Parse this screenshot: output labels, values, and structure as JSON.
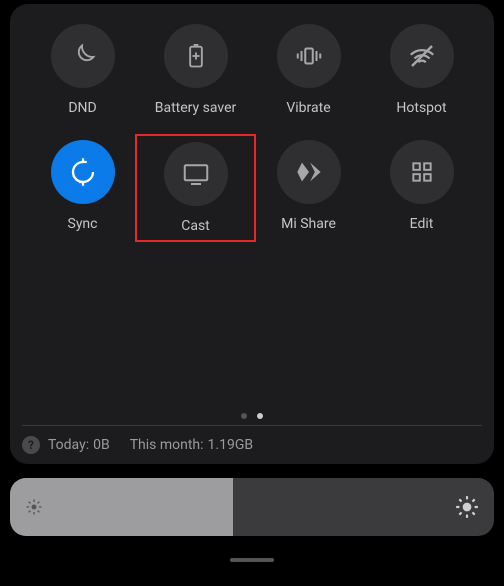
{
  "tiles": {
    "dnd": {
      "label": "DND",
      "active": false
    },
    "battery_saver": {
      "label": "Battery saver",
      "active": false
    },
    "vibrate": {
      "label": "Vibrate",
      "active": false
    },
    "hotspot": {
      "label": "Hotspot",
      "active": false
    },
    "sync": {
      "label": "Sync",
      "active": true
    },
    "cast": {
      "label": "Cast",
      "active": false,
      "highlighted": true
    },
    "mi_share": {
      "label": "Mi Share",
      "active": false
    },
    "edit": {
      "label": "Edit",
      "active": false
    }
  },
  "pagination": {
    "total": 2,
    "current": 2
  },
  "data_usage": {
    "today_label": "Today:",
    "today_value": "0B",
    "month_label": "This month:",
    "month_value": "1.19GB"
  },
  "brightness": {
    "percent": 46
  },
  "colors": {
    "panel_bg": "#1c1c1e",
    "tile_bg": "#2f2f31",
    "tile_active": "#0a7be8",
    "highlight": "#e62828"
  }
}
